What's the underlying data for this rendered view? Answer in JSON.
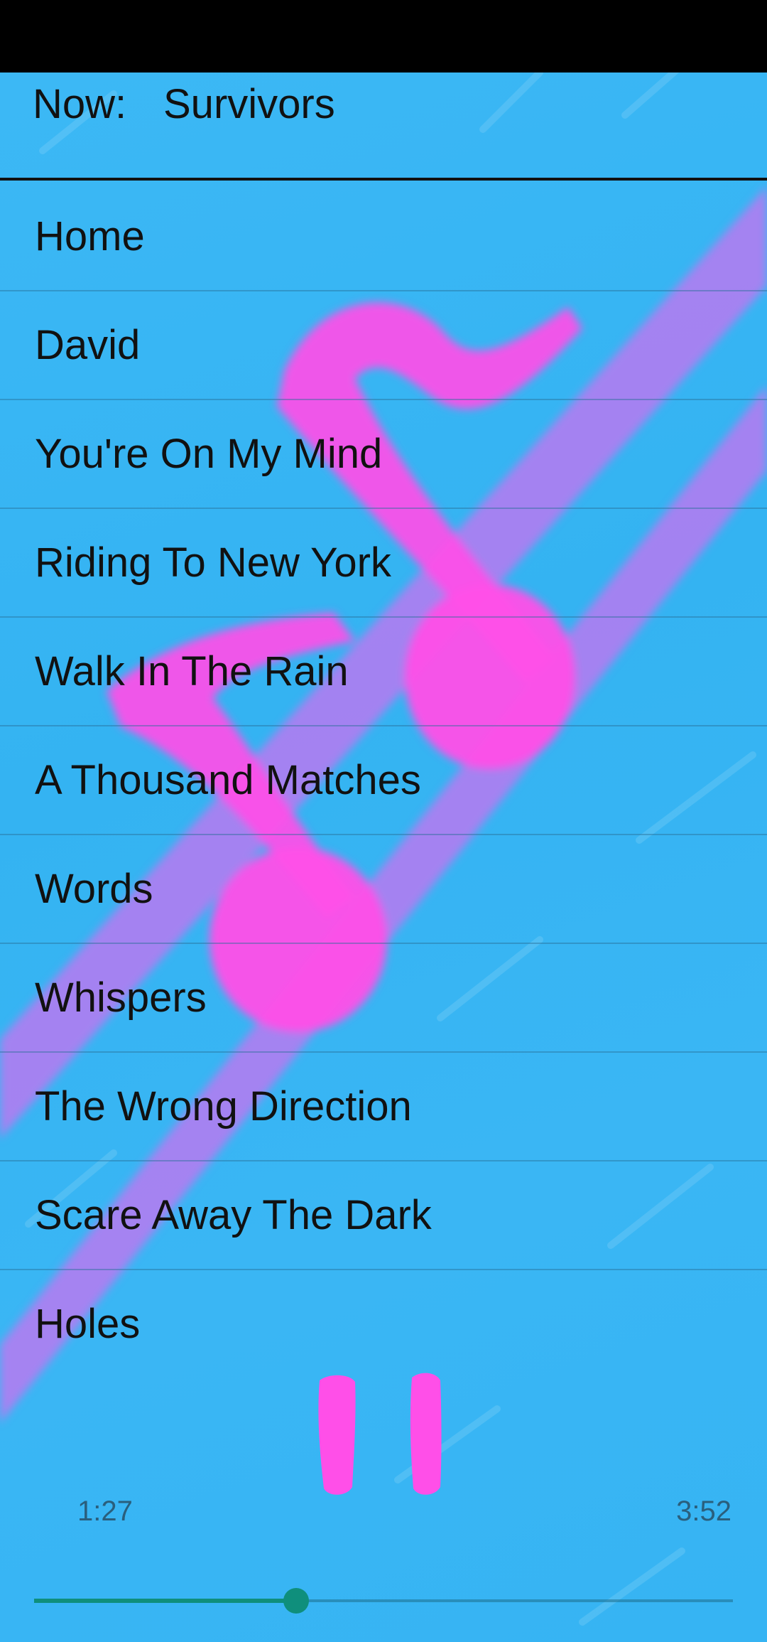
{
  "now_playing": {
    "label": "Now:",
    "title": "Survivors"
  },
  "tracks": [
    {
      "title": "Home"
    },
    {
      "title": "David"
    },
    {
      "title": "You're On My Mind"
    },
    {
      "title": "Riding To New York"
    },
    {
      "title": "Walk In The Rain"
    },
    {
      "title": "A Thousand Matches"
    },
    {
      "title": "Words"
    },
    {
      "title": "Whispers"
    },
    {
      "title": "The Wrong Direction"
    },
    {
      "title": "Scare Away The Dark"
    },
    {
      "title": "Holes"
    }
  ],
  "player": {
    "elapsed": "1:27",
    "total": "3:52",
    "progress": 0.375,
    "pause_icon": "pause-icon"
  },
  "colors": {
    "background": "#36b4f3",
    "accent": "#0f8f7c",
    "artwork": "#ff4fe8"
  }
}
